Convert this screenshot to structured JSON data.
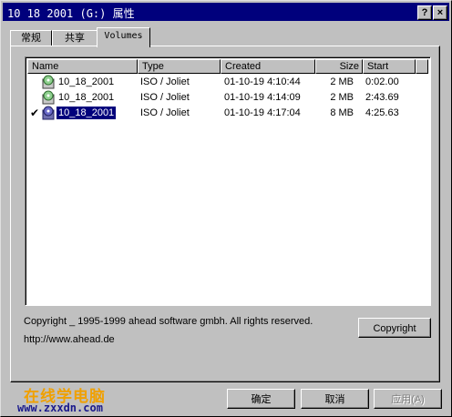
{
  "window": {
    "title": "10 18 2001 (G:) 属性",
    "help_glyph": "?",
    "close_glyph": "×"
  },
  "tabs": [
    {
      "label": "常规"
    },
    {
      "label": "共享"
    },
    {
      "label": "Volumes"
    }
  ],
  "list": {
    "columns": [
      "Name",
      "Type",
      "Created",
      "Size",
      "Start"
    ],
    "rows": [
      {
        "name": "10_18_2001",
        "type": "ISO / Joliet",
        "created": "01-10-19 4:10:44",
        "size": "2 MB",
        "start": "0:02.00",
        "checked": false,
        "selected": false
      },
      {
        "name": "10_18_2001",
        "type": "ISO / Joliet",
        "created": "01-10-19 4:14:09",
        "size": "2 MB",
        "start": "2:43.69",
        "checked": false,
        "selected": false
      },
      {
        "name": "10_18_2001",
        "type": "ISO / Joliet",
        "created": "01-10-19 4:17:04",
        "size": "8 MB",
        "start": "4:25.63",
        "checked": true,
        "selected": true
      }
    ],
    "check_glyph": "✔"
  },
  "info": {
    "copyright_text": "Copyright _ 1995-1999 ahead software gmbh. All rights reserved.",
    "url": "http://www.ahead.de",
    "copyright_button": "Copyright"
  },
  "footer": {
    "ok": "确定",
    "cancel": "取消",
    "apply": "应用(A)"
  },
  "watermark": {
    "line1": "在线学电脑",
    "line2": "www.zxxdn.com"
  }
}
